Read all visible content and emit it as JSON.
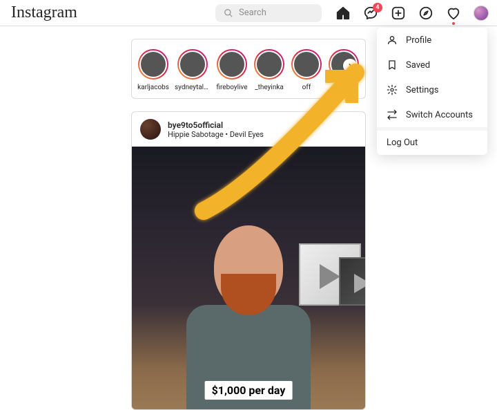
{
  "header": {
    "logo_text": "Instagram",
    "search_placeholder": "Search",
    "messages_badge": "4"
  },
  "stories": [
    {
      "username": "karljacobs"
    },
    {
      "username": "sydneytalker"
    },
    {
      "username": "fireboylive"
    },
    {
      "username": "_theyinka"
    },
    {
      "username": "off"
    },
    {
      "username": ""
    }
  ],
  "post": {
    "username": "bye9to5official",
    "subtitle": "Hippie Sabotage • Devil Eyes",
    "caption": "$1,000 per day"
  },
  "menu": {
    "profile": "Profile",
    "saved": "Saved",
    "settings": "Settings",
    "switch": "Switch Accounts",
    "logout": "Log Out"
  }
}
